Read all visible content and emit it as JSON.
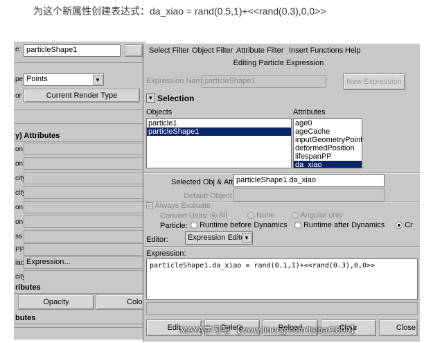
{
  "caption": "为这个新属性创建表达式：da_xiao = rand(0.5,1)+<<rand(0.3),0,0>>",
  "left_panel": {
    "shape_label": "e:",
    "shape_value": "particleShape1",
    "type_label": "pe",
    "type_value": "Points",
    "render_label": "or",
    "render_button": "Current Render Type",
    "per_particle_section": "y) Attributes",
    "attr_rows": [
      {
        "label": "on",
        "value": ""
      },
      {
        "label": "on",
        "value": ""
      },
      {
        "label": "city",
        "value": ""
      },
      {
        "label": "city",
        "value": ""
      },
      {
        "label": "on",
        "value": ""
      },
      {
        "label": "on",
        "value": ""
      },
      {
        "label": "ss",
        "value": ""
      },
      {
        "label": "PP",
        "value": ""
      },
      {
        "label": "iao",
        "value": "Expression..."
      },
      {
        "label": "city",
        "value": ""
      }
    ],
    "add_attr_section": "ributes",
    "opacity_button": "Opacity",
    "color_button": "Color",
    "render_attr_section": "butes"
  },
  "editor": {
    "menu": [
      "Select Filter",
      "Object Filter",
      "Attribute Filter",
      "Insert Functions",
      "Help"
    ],
    "title": "Editing Particle Expression",
    "expression_name_label": "Expression Name",
    "expression_name_value": "particleShape1",
    "new_expression_button": "New Expression",
    "selection_heading": "Selection",
    "objects_label": "Objects",
    "attributes_label": "Attributes",
    "objects": [
      {
        "label": "particle1",
        "selected": false
      },
      {
        "label": "particleShape1",
        "selected": true
      }
    ],
    "attributes": [
      {
        "label": "age0",
        "selected": false
      },
      {
        "label": "ageCache",
        "selected": false
      },
      {
        "label": "inputGeometryPoints",
        "selected": false
      },
      {
        "label": "deformedPosition",
        "selected": false
      },
      {
        "label": "lifespanPP",
        "selected": false
      },
      {
        "label": "da_xiao",
        "selected": true
      }
    ],
    "selected_obj_attr_label": "Selected Obj & Attr",
    "selected_obj_attr_value": "particleShape1.da_xiao",
    "default_object_label": "Default Object",
    "default_object_value": "",
    "always_evaluate_label": "Always Evaluate",
    "convert_units_label": "Convert Units:",
    "convert_units_options": [
      "All",
      "None",
      "Angular only"
    ],
    "particle_label": "Particle:",
    "particle_options": [
      "Runtime before Dynamics",
      "Runtime after Dynamics",
      "Cr"
    ],
    "editor_label": "Editor:",
    "editor_value": "Expression Editor",
    "expression_label": "Expression:",
    "expression_text": "particleShape1.da_xiao = rand(0.1,1)+<<rand(0.3),0,0>>",
    "bottom_buttons": [
      "Edit",
      "Delete",
      "Reload",
      "Clear",
      "Close"
    ]
  },
  "watermark": "MAYA学习吧 【www.linecg.com/tieba/1800】",
  "colors": {
    "selection": "#0a246a",
    "panel": "#c8c8c8"
  }
}
